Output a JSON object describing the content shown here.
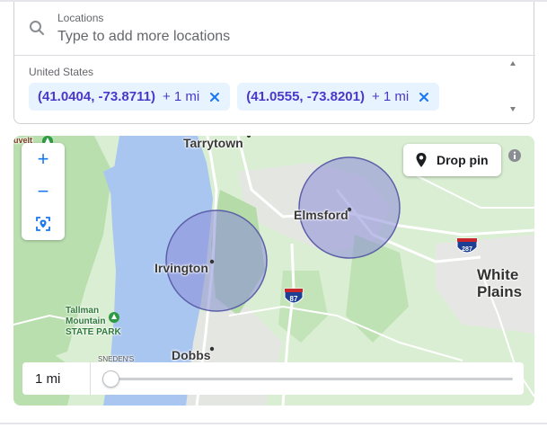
{
  "locations": {
    "label": "Locations",
    "placeholder": "Type to add more locations",
    "country": "United States",
    "chips": [
      {
        "coord": "(41.0404, -73.8711)",
        "radius": "+ 1 mi"
      },
      {
        "coord": "(41.0555, -73.8201)",
        "radius": "+ 1 mi"
      }
    ]
  },
  "map": {
    "labels": {
      "tarrytown": "Tarrytown",
      "elmsford": "Elmsford",
      "irvington": "Irvington",
      "dobbs": "Dobbs",
      "white_plains_1": "White",
      "white_plains_2": "Plains",
      "tallman_1": "Tallman",
      "tallman_2": "Mountain",
      "tallman_3": "STATE PARK",
      "sneden": "SNEDEN'S",
      "roosevelt": "uvelt"
    },
    "shields": {
      "i87": "87",
      "i287": "287"
    },
    "zoom_in": "+",
    "zoom_out": "−",
    "drop_pin_label": "Drop pin",
    "radius_label": "1 mi",
    "radius_slider_fraction": 0.0
  },
  "colors": {
    "accent": "#1877f2",
    "chip_bg": "#e7f3ff",
    "chip_text": "#4b38c9",
    "water": "#a9c6f0",
    "park": "#b4dba8",
    "circle_fill": "#8a8cd8"
  }
}
